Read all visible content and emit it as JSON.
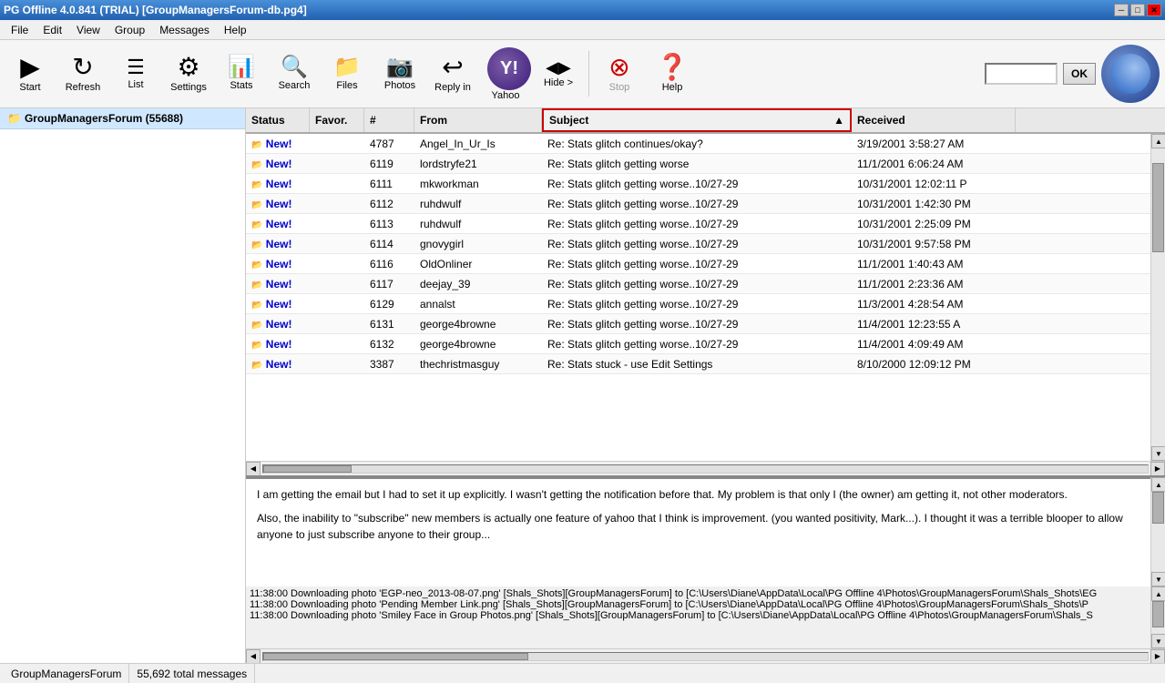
{
  "window": {
    "title": "PG Offline 4.0.841 (TRIAL) [GroupManagersForum-db.pg4]"
  },
  "menu": {
    "items": [
      "File",
      "Edit",
      "View",
      "Group",
      "Messages",
      "Help"
    ]
  },
  "toolbar": {
    "buttons": [
      {
        "label": "Start",
        "icon": "▶",
        "name": "start-button",
        "disabled": false
      },
      {
        "label": "Refresh",
        "icon": "↻",
        "name": "refresh-button",
        "disabled": false
      },
      {
        "label": "List",
        "icon": "☰",
        "name": "list-button",
        "disabled": false
      },
      {
        "label": "Settings",
        "icon": "⚙",
        "name": "settings-button",
        "disabled": false
      },
      {
        "label": "Stats",
        "icon": "📊",
        "name": "stats-button",
        "disabled": false
      },
      {
        "label": "Search",
        "icon": "🔍",
        "name": "search-button",
        "disabled": false
      },
      {
        "label": "Files",
        "icon": "📁",
        "name": "files-button",
        "disabled": false
      },
      {
        "label": "Photos",
        "icon": "📷",
        "name": "photos-button",
        "disabled": false
      },
      {
        "label": "Reply in",
        "icon": "↩",
        "name": "reply-button",
        "disabled": false
      },
      {
        "label": "Yahoo",
        "icon": "Y",
        "name": "yahoo-button",
        "disabled": false
      },
      {
        "label": "Hide >",
        "icon": "◀▶",
        "name": "hide-button",
        "disabled": false
      },
      {
        "label": "Stop",
        "icon": "⛔",
        "name": "stop-button",
        "disabled": false
      },
      {
        "label": "Help",
        "icon": "?",
        "name": "help-button",
        "disabled": false
      }
    ],
    "ok_button": "OK"
  },
  "sidebar": {
    "group_name": "GroupManagersForum (55688)"
  },
  "table": {
    "columns": [
      "Status",
      "Favor.",
      "#",
      "From",
      "Subject",
      "Received"
    ],
    "rows": [
      {
        "status": "New!",
        "favor": "",
        "num": "4787",
        "from": "Angel_In_Ur_Is",
        "subject": "Re: Stats glitch continues/okay?",
        "received": "3/19/2001 3:58:27 AM"
      },
      {
        "status": "New!",
        "favor": "",
        "num": "6119",
        "from": "lordstryfe21",
        "subject": "Re: Stats glitch getting worse",
        "received": "11/1/2001 6:06:24 AM"
      },
      {
        "status": "New!",
        "favor": "",
        "num": "6111",
        "from": "mkworkman",
        "subject": "Re: Stats glitch getting worse..10/27-29",
        "received": "10/31/2001 12:02:11 P"
      },
      {
        "status": "New!",
        "favor": "",
        "num": "6112",
        "from": "ruhdwulf",
        "subject": "Re: Stats glitch getting worse..10/27-29",
        "received": "10/31/2001 1:42:30 PM"
      },
      {
        "status": "New!",
        "favor": "",
        "num": "6113",
        "from": "ruhdwulf",
        "subject": "Re: Stats glitch getting worse..10/27-29",
        "received": "10/31/2001 2:25:09 PM"
      },
      {
        "status": "New!",
        "favor": "",
        "num": "6114",
        "from": "gnovygirl",
        "subject": "Re: Stats glitch getting worse..10/27-29",
        "received": "10/31/2001 9:57:58 PM"
      },
      {
        "status": "New!",
        "favor": "",
        "num": "6116",
        "from": "OldOnliner",
        "subject": "Re: Stats glitch getting worse..10/27-29",
        "received": "11/1/2001 1:40:43 AM"
      },
      {
        "status": "New!",
        "favor": "",
        "num": "6117",
        "from": "deejay_39",
        "subject": "Re: Stats glitch getting worse..10/27-29",
        "received": "11/1/2001 2:23:36 AM"
      },
      {
        "status": "New!",
        "favor": "",
        "num": "6129",
        "from": "annalst",
        "subject": "Re: Stats glitch getting worse..10/27-29",
        "received": "11/3/2001 4:28:54 AM"
      },
      {
        "status": "New!",
        "favor": "",
        "num": "6131",
        "from": "george4browne",
        "subject": "Re: Stats glitch getting worse..10/27-29",
        "received": "11/4/2001 12:23:55 A"
      },
      {
        "status": "New!",
        "favor": "",
        "num": "6132",
        "from": "george4browne",
        "subject": "Re: Stats glitch getting worse..10/27-29",
        "received": "11/4/2001 4:09:49 AM"
      },
      {
        "status": "New!",
        "favor": "",
        "num": "3387",
        "from": "thechristmasguy",
        "subject": "Re: Stats stuck - use Edit Settings",
        "received": "8/10/2000 12:09:12 PM"
      }
    ]
  },
  "preview": {
    "text1": "I am getting the email but I had to set it up explicitly. I wasn't getting the notification before that. My problem is that only I (the owner) am getting it, not other moderators.",
    "text2": "Also, the inability to \"subscribe\" new members is actually one feature of yahoo that I think is improvement. (you wanted positivity, Mark...). I thought it was a terrible blooper to allow anyone to just subscribe anyone to their group..."
  },
  "log": {
    "lines": [
      "11:38:00 Downloading photo 'EGP-neo_2013-08-07.png' [Shals_Shots][GroupManagersForum] to [C:\\Users\\Diane\\AppData\\Local\\PG Offline 4\\Photos\\GroupManagersForum\\Shals_Shots\\EG",
      "11:38:00 Downloading photo 'Pending Member Link.png' [Shals_Shots][GroupManagersForum] to [C:\\Users\\Diane\\AppData\\Local\\PG Offline 4\\Photos\\GroupManagersForum\\Shals_Shots\\P",
      "11:38:00 Downloading photo 'Smiley Face in Group Photos.png' [Shals_Shots][GroupManagersForum] to [C:\\Users\\Diane\\AppData\\Local\\PG Offline 4\\Photos\\GroupManagersForum\\Shals_S"
    ]
  },
  "statusbar": {
    "group": "GroupManagersForum",
    "message_count": "55,692 total messages"
  }
}
